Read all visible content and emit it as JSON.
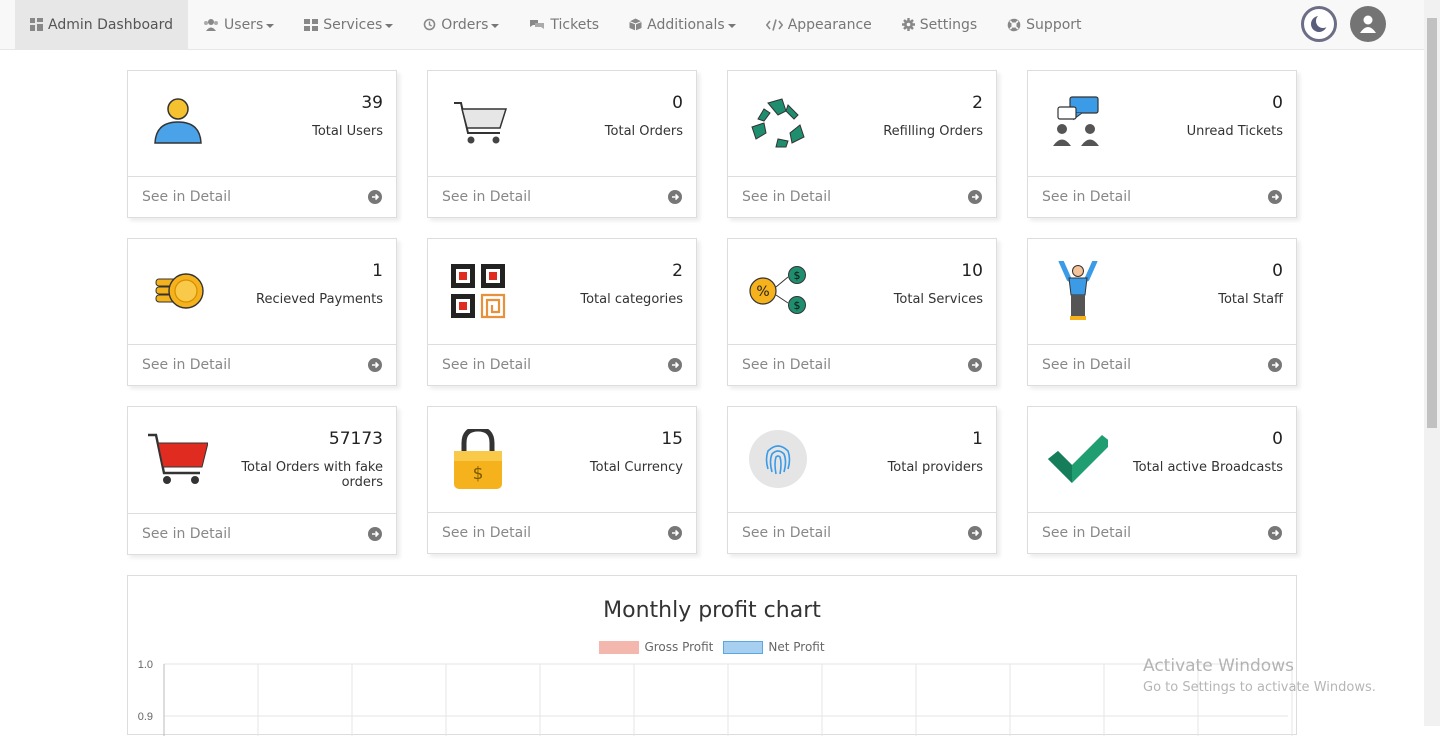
{
  "nav": {
    "items": [
      {
        "label": "Admin Dashboard",
        "icon": "dashboard-icon",
        "active": true,
        "caret": false
      },
      {
        "label": "Users",
        "icon": "users-icon",
        "caret": true
      },
      {
        "label": "Services",
        "icon": "services-icon",
        "caret": true
      },
      {
        "label": "Orders",
        "icon": "history-icon",
        "caret": true
      },
      {
        "label": "Tickets",
        "icon": "tickets-icon",
        "caret": false
      },
      {
        "label": "Additionals",
        "icon": "box-icon",
        "caret": true
      },
      {
        "label": "Appearance",
        "icon": "code-icon",
        "caret": false
      },
      {
        "label": "Settings",
        "icon": "gear-icon",
        "caret": false
      },
      {
        "label": "Support",
        "icon": "lifebuoy-icon",
        "caret": false
      }
    ]
  },
  "cards": [
    {
      "value": "39",
      "label": "Total Users",
      "footer": "See in Detail",
      "icon": "user-icon"
    },
    {
      "value": "0",
      "label": "Total Orders",
      "footer": "See in Detail",
      "icon": "cart-icon"
    },
    {
      "value": "2",
      "label": "Refilling Orders",
      "footer": "See in Detail",
      "icon": "recycle-icon"
    },
    {
      "value": "0",
      "label": "Unread Tickets",
      "footer": "See in Detail",
      "icon": "chat-people-icon"
    },
    {
      "value": "1",
      "label": "Recieved Payments",
      "footer": "See in Detail",
      "icon": "coins-icon"
    },
    {
      "value": "2",
      "label": "Total categories",
      "footer": "See in Detail",
      "icon": "categories-icon"
    },
    {
      "value": "10",
      "label": "Total Services",
      "footer": "See in Detail",
      "icon": "percent-dollar-icon"
    },
    {
      "value": "0",
      "label": "Total Staff",
      "footer": "See in Detail",
      "icon": "staff-icon"
    },
    {
      "value": "57173",
      "label": "Total Orders with fake orders",
      "footer": "See in Detail",
      "icon": "red-cart-icon"
    },
    {
      "value": "15",
      "label": "Total Currency",
      "footer": "See in Detail",
      "icon": "lock-dollar-icon"
    },
    {
      "value": "1",
      "label": "Total providers",
      "footer": "See in Detail",
      "icon": "fingerprint-icon"
    },
    {
      "value": "0",
      "label": "Total active Broadcasts",
      "footer": "See in Detail",
      "icon": "checkmark-icon"
    }
  ],
  "chart": {
    "title": "Monthly profit chart",
    "legend": [
      {
        "name": "Gross Profit",
        "color": "#f4b7ae"
      },
      {
        "name": "Net Profit",
        "color": "#a6cff0"
      }
    ]
  },
  "chart_data": {
    "type": "line",
    "title": "Monthly profit chart",
    "series": [
      {
        "name": "Gross Profit",
        "values": []
      },
      {
        "name": "Net Profit",
        "values": []
      }
    ],
    "y_ticks": [
      "1.0",
      "0.9"
    ],
    "grid": true,
    "legend": "top"
  },
  "watermark": {
    "line1": "Activate Windows",
    "line2": "Go to Settings to activate Windows."
  }
}
